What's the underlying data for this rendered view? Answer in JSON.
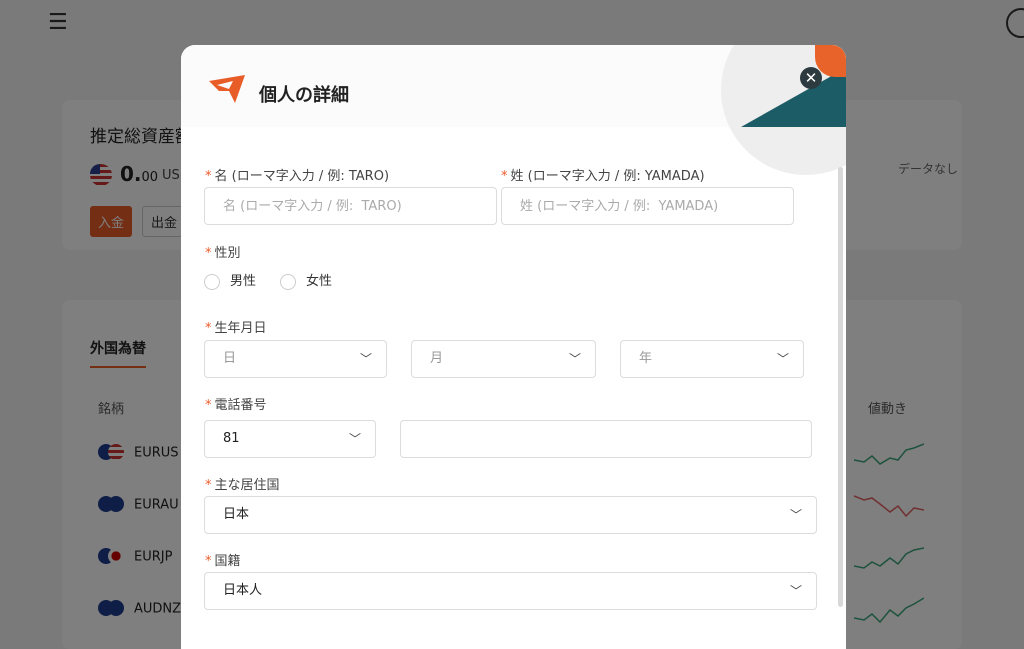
{
  "background": {
    "menu_icon": "hamburger-icon",
    "assets_title": "推定総資産額",
    "balance_int": "0.",
    "balance_dec": "00",
    "currency": "US",
    "deposit_label": "入金",
    "withdraw_label": "出金",
    "no_data": "データなし",
    "tab_fx": "外国為替",
    "col_symbol": "銘柄",
    "col_move": "値動き",
    "rows": [
      {
        "symbol": "EURUS",
        "trend": "up",
        "color": "#3aa57a"
      },
      {
        "symbol": "EURAU",
        "trend": "down",
        "color": "#e06060"
      },
      {
        "symbol": "EURJP",
        "trend": "up",
        "color": "#3aa57a"
      },
      {
        "symbol": "AUDNZ",
        "trend": "up",
        "color": "#3aa57a"
      }
    ]
  },
  "modal": {
    "title": "個人の詳細",
    "close_icon": "close-icon",
    "accent_color": "#e85c28",
    "first_name": {
      "label": "名 (ローマ字入力 / 例:  TARO)",
      "placeholder": "名 (ローマ字入力 / 例:  TARO)",
      "value": ""
    },
    "last_name": {
      "label": "姓 (ローマ字入力 / 例:  YAMADA)",
      "placeholder": "姓 (ローマ字入力 / 例:  YAMADA)",
      "value": ""
    },
    "gender": {
      "label": "性別",
      "options": [
        "男性",
        "女性"
      ]
    },
    "birthdate": {
      "label": "生年月日",
      "day": "日",
      "month": "月",
      "year": "年"
    },
    "phone": {
      "label": "電話番号",
      "country_code": "81",
      "value": ""
    },
    "residence": {
      "label": "主な居住国",
      "value": "日本"
    },
    "nationality": {
      "label": "国籍",
      "value": "日本人"
    },
    "required_mark": "*",
    "chevron_icon": "chevron-down-icon"
  }
}
